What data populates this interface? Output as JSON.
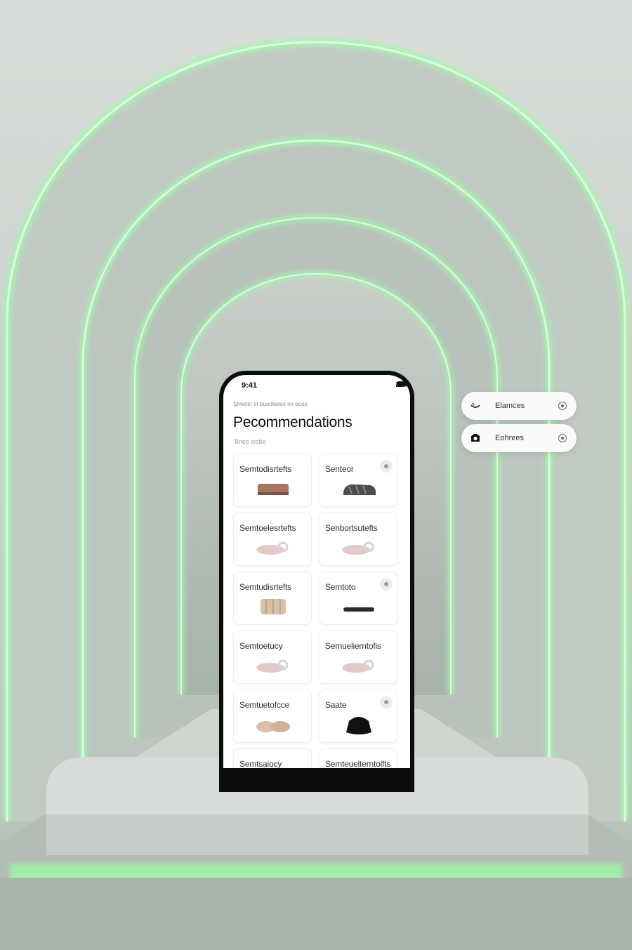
{
  "status_bar": {
    "time": "9:41"
  },
  "header": {
    "breadcrumb": "Shwoin ei buodisesx ex ooos",
    "title": "Pecommendations",
    "subtitle": "Bnes losbe"
  },
  "cards": [
    {
      "name": "Semtodisrtefts",
      "product": "clog-brown",
      "has_dot": false
    },
    {
      "name": "Senteor",
      "product": "sandal-dark",
      "has_dot": true
    },
    {
      "name": "Semtoelesrtefts",
      "product": "slide-pink",
      "has_dot": false
    },
    {
      "name": "Senbortsutefts",
      "product": "slide-pink",
      "has_dot": false
    },
    {
      "name": "Semtudisrtefts",
      "product": "boot-beige",
      "has_dot": false
    },
    {
      "name": "Semtoto",
      "product": "sole-black",
      "has_dot": true
    },
    {
      "name": "Semtoetucy",
      "product": "slide-pink",
      "has_dot": false
    },
    {
      "name": "Semuelierntofis",
      "product": "slide-pink",
      "has_dot": false
    },
    {
      "name": "Semtuetofcce",
      "product": "slipper-beige",
      "has_dot": false
    },
    {
      "name": "Saate",
      "product": "bag-black",
      "has_dot": true
    },
    {
      "name": "Semtsaiocy",
      "product": "",
      "has_dot": false
    },
    {
      "name": "Semteuelterntolfts",
      "product": "",
      "has_dot": false
    }
  ],
  "chips": [
    {
      "label": "Elamces",
      "icon": "bowl-icon"
    },
    {
      "label": "Eohnres",
      "icon": "camera-icon"
    }
  ],
  "colors": {
    "accent_glow": "#9af5a6",
    "wall": "#c5ccc7"
  }
}
